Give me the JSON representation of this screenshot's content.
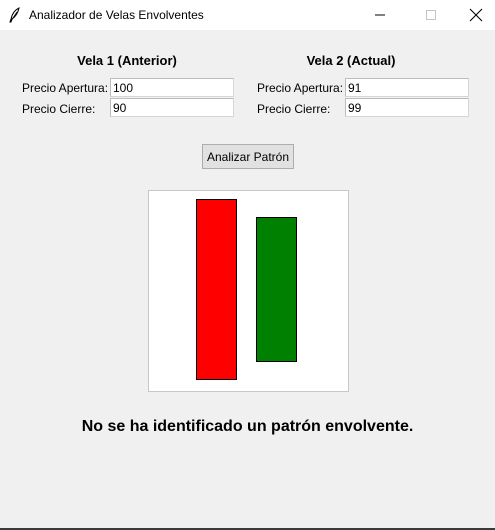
{
  "window": {
    "title": "Analizador de Velas Envolventes",
    "icon": "feather-icon",
    "controls": [
      "minimize-icon",
      "maximize-icon",
      "close-icon"
    ]
  },
  "candle1": {
    "heading": "Vela 1 (Anterior)",
    "open_label": "Precio Apertura:",
    "open_value": "100",
    "close_label": "Precio Cierre:",
    "close_value": "90",
    "color": "#ff0000"
  },
  "candle2": {
    "heading": "Vela 2 (Actual)",
    "open_label": "Precio Apertura:",
    "open_value": "91",
    "close_label": "Precio Cierre:",
    "close_value": "99",
    "color": "#008000"
  },
  "analyze_button": "Analizar Patrón",
  "result_text": "No se ha identificado un patrón envolvente."
}
